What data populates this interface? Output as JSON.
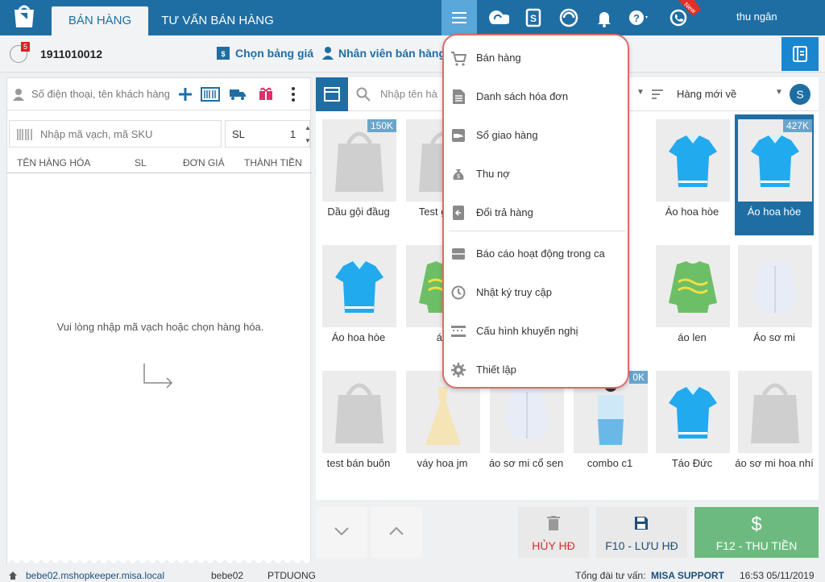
{
  "tabs": [
    {
      "label": "BÁN HÀNG"
    },
    {
      "label": "TƯ VẤN BÁN HÀNG"
    }
  ],
  "user": {
    "name": "thu ngân"
  },
  "new_badge": "New",
  "order": {
    "cart_count": "5",
    "number": "1911010012"
  },
  "links": {
    "price_list": "Chọn bảng giá",
    "staff": "Nhân viên bán hàng"
  },
  "customer": {
    "placeholder": "Số điện thoại, tên khách hàng"
  },
  "sku": {
    "placeholder": "Nhập mã vạch, mã SKU",
    "qty_label": "SL",
    "qty_value": "1"
  },
  "table_headers": [
    "TÊN HÀNG HÓA",
    "SL",
    "ĐƠN GIÁ",
    "THÀNH TIỀN"
  ],
  "empty_message": "Vui lòng nhập mã vạch hoặc chọn hàng hóa.",
  "product_search": {
    "placeholder": "Nhập tên hà",
    "sort": "Hàng mới về",
    "currency_icon": "S"
  },
  "products": [
    {
      "name": "Dầu gội đầug",
      "price": "150K"
    },
    {
      "name": "Test g khc",
      "price": ""
    },
    {
      "name": "e",
      "price": ""
    },
    {
      "name": "Áo hoa hòe",
      "price": ""
    },
    {
      "name": "Áo hoa hòe",
      "price": "427K"
    },
    {
      "name": "Áo hoa hòe",
      "price": ""
    },
    {
      "name": "áo",
      "price": ""
    },
    {
      "name": "áo len",
      "price": ""
    },
    {
      "name": "Áo sơ mi",
      "price": ""
    },
    {
      "name": "test bán buôn",
      "price": ""
    },
    {
      "name": "váy hoa jm",
      "price": ""
    },
    {
      "name": "áo sơ mi cổ sen",
      "price": ""
    },
    {
      "name": "combo c1",
      "price": "0K"
    },
    {
      "name": "Táo Đức",
      "price": ""
    },
    {
      "name": "áo sơ mi hoa nhí",
      "price": ""
    }
  ],
  "menu": [
    {
      "label": "Bán hàng",
      "icon": "cart-icon"
    },
    {
      "label": "Danh sách hóa đơn",
      "icon": "document-icon"
    },
    {
      "label": "Sổ giao hàng",
      "icon": "truck-icon"
    },
    {
      "label": "Thu nợ",
      "icon": "money-bag-icon"
    },
    {
      "label": "Đổi trả hàng",
      "icon": "return-icon"
    },
    {
      "label": "Báo cáo hoạt động trong ca",
      "icon": "report-icon"
    },
    {
      "label": "Nhật ký truy cập",
      "icon": "history-icon"
    },
    {
      "label": "Cấu hình khuyến nghị",
      "icon": "config-icon"
    },
    {
      "label": "Thiết lập",
      "icon": "gear-icon"
    }
  ],
  "actions": {
    "cancel": "HỦY HĐ",
    "save": "F10 - LƯU HĐ",
    "pay": "F12 - THU TIỀN",
    "pay_icon": "$"
  },
  "status_bar": {
    "domain": "bebe02.mshopkeeper.misa.local",
    "shop": "bebe02",
    "user": "PTDUONG",
    "support_label": "Tổng đài tư vấn:",
    "support": "MISA SUPPORT",
    "datetime": "16:53 05/11/2019"
  },
  "colors": {
    "primary": "#1f6ea3",
    "accent_green": "#6cba7f",
    "danger": "#d32f2f",
    "highlight_border": "#e06a6a"
  }
}
